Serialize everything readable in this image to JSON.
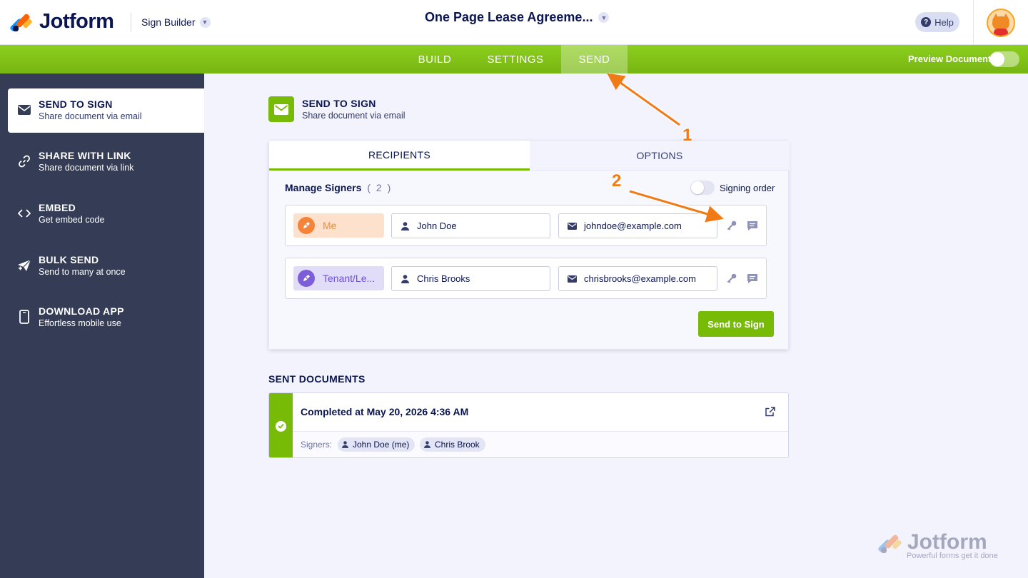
{
  "header": {
    "logo_text": "Jotform",
    "builder_label": "Sign Builder",
    "doc_title": "One Page Lease Agreeme...",
    "help_label": "Help"
  },
  "nav": {
    "tabs": [
      "BUILD",
      "SETTINGS",
      "SEND"
    ],
    "active_tab": "SEND",
    "preview_label": "Preview Document",
    "preview_on": false
  },
  "sidebar": {
    "items": [
      {
        "title": "SEND TO SIGN",
        "subtitle": "Share document via email",
        "icon": "envelope-icon",
        "active": true
      },
      {
        "title": "SHARE WITH LINK",
        "subtitle": "Share document via link",
        "icon": "link-icon"
      },
      {
        "title": "EMBED",
        "subtitle": "Get embed code",
        "icon": "code-icon"
      },
      {
        "title": "BULK SEND",
        "subtitle": "Send to many at once",
        "icon": "paper-plane-icon"
      },
      {
        "title": "DOWNLOAD APP",
        "subtitle": "Effortless mobile use",
        "icon": "phone-icon"
      }
    ]
  },
  "main": {
    "title": "SEND TO SIGN",
    "subtitle": "Share document via email",
    "tabs": [
      "RECIPIENTS",
      "OPTIONS"
    ],
    "manage_signers_label": "Manage Signers",
    "signer_count": "( 2 )",
    "signing_order_label": "Signing order",
    "signing_order_on": false,
    "signers": [
      {
        "role": "Me",
        "name": "John Doe",
        "email": "johndoe@example.com",
        "role_color": "#f5843b"
      },
      {
        "role": "Tenant/Le...",
        "name": "Chris Brooks",
        "email": "chrisbrooks@example.com",
        "role_color": "#7c5ed9"
      }
    ],
    "send_button": "Send to Sign"
  },
  "sent": {
    "title": "SENT DOCUMENTS",
    "status": "Completed at May 20, 2026 4:36 AM",
    "signers_label": "Signers:",
    "signers": [
      "John Doe (me)",
      "Chris Brook"
    ]
  },
  "watermark": {
    "brand": "Jotform",
    "tagline": "Powerful forms get it done"
  },
  "annotations": [
    "1",
    "2"
  ],
  "colors": {
    "accent": "#78bb07",
    "sidebar": "#343c56",
    "annotation": "#f07a16"
  }
}
